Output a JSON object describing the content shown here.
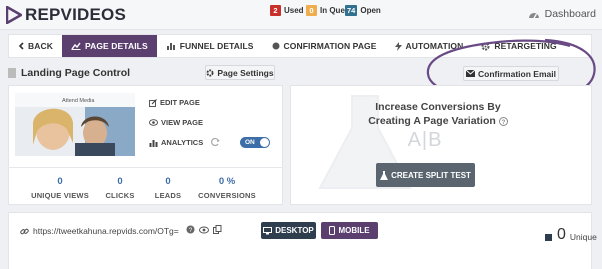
{
  "app": {
    "name": "REPVIDEOS"
  },
  "status": [
    {
      "count": "2",
      "label": "Used",
      "color": "#c9302c"
    },
    {
      "count": "0",
      "label": "In Que",
      "color": "#f0ad4e"
    },
    {
      "count": "74",
      "label": "Open",
      "color": "#31708f"
    }
  ],
  "header": {
    "dashboard_label": "Dashboard"
  },
  "nav": {
    "back_label": "BACK",
    "tabs": [
      {
        "label": "PAGE DETAILS",
        "active": true
      },
      {
        "label": "FUNNEL DETAILS"
      },
      {
        "label": "CONFIRMATION PAGE"
      },
      {
        "label": "AUTOMATION"
      },
      {
        "label": "RETARGETING"
      }
    ]
  },
  "page": {
    "title": "Landing Page Control",
    "settings_button": "Page Settings",
    "confirmation_email_button": "Confirmation Email"
  },
  "preview": {
    "thumbnail_text": "Attend Media",
    "menu": {
      "edit": "EDIT PAGE",
      "view": "VIEW PAGE",
      "analytics": "ANALYTICS",
      "toggle": "ON"
    }
  },
  "stats": [
    {
      "value": "0",
      "label": "UNIQUE VIEWS"
    },
    {
      "value": "0",
      "label": "CLICKS"
    },
    {
      "value": "0",
      "label": "LEADS"
    },
    {
      "value": "0 %",
      "label": "CONVERSIONS"
    }
  ],
  "split_test": {
    "heading_line1": "Increase Conversions By",
    "heading_line2": "Creating A Page Variation",
    "ab_label": "A|B",
    "button": "CREATE SPLIT TEST"
  },
  "bottom": {
    "url": "https://tweetkahuna.repvids.com/OTg=",
    "desktop_button": "DESKTOP",
    "mobile_button": "MOBILE",
    "unique_value": "0",
    "unique_label": "Unique"
  },
  "colors": {
    "accent_purple": "#5b3f6f",
    "dark_button": "#2f3e4e",
    "split_button": "#5a6570",
    "link_blue": "#3d6ea8"
  }
}
